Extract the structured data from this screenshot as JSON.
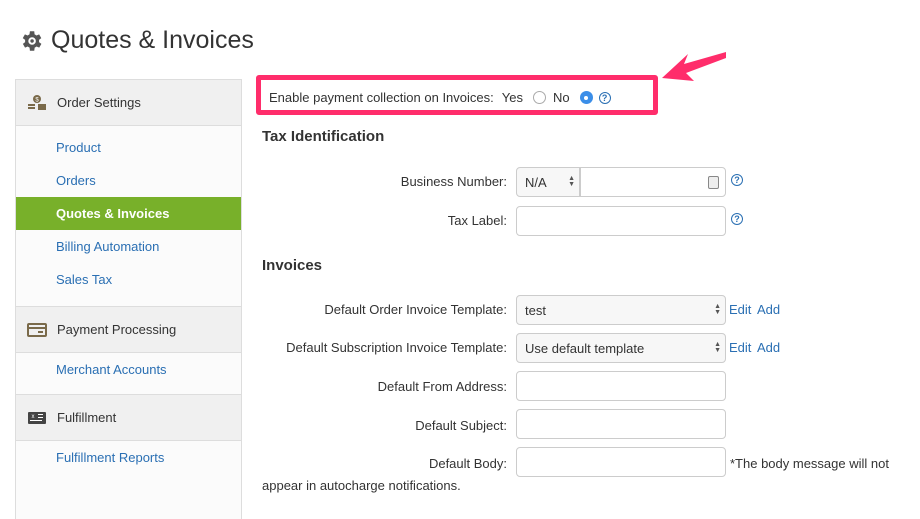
{
  "page": {
    "title": "Quotes & Invoices"
  },
  "sidebar": {
    "sections": [
      {
        "header": "Order Settings",
        "icon": "money-stack-icon",
        "items": [
          {
            "label": "Product",
            "active": false
          },
          {
            "label": "Orders",
            "active": false
          },
          {
            "label": "Quotes & Invoices",
            "active": true
          },
          {
            "label": "Billing Automation",
            "active": false
          },
          {
            "label": "Sales Tax",
            "active": false
          }
        ]
      },
      {
        "header": "Payment Processing",
        "icon": "credit-card-icon",
        "items": [
          {
            "label": "Merchant Accounts",
            "active": false
          }
        ]
      },
      {
        "header": "Fulfillment",
        "icon": "fulfillment-icon",
        "items": [
          {
            "label": "Fulfillment Reports",
            "active": false
          }
        ]
      }
    ]
  },
  "enable_payment": {
    "label": "Enable payment collection on Invoices:",
    "yes_label": "Yes",
    "no_label": "No",
    "selected": "No",
    "highlight_color": "#ff2d6b"
  },
  "tax": {
    "title": "Tax Identification",
    "business_number_label": "Business Number:",
    "business_number_type": "N/A",
    "business_number_value": "",
    "tax_label_label": "Tax Label:",
    "tax_label_value": ""
  },
  "invoices": {
    "title": "Invoices",
    "order_template_label": "Default Order Invoice Template:",
    "order_template_value": "test",
    "subscription_template_label": "Default Subscription Invoice Template:",
    "subscription_template_value": "Use default template",
    "edit_label": "Edit",
    "add_label": "Add",
    "from_address_label": "Default From Address:",
    "from_address_value": "",
    "subject_label": "Default Subject:",
    "subject_value": "",
    "body_label": "Default Body:",
    "body_value": "",
    "body_note_line1": "*The body message will not",
    "body_note_line2": "appear in autocharge notifications."
  },
  "colors": {
    "accent_green": "#78b02a",
    "link_blue": "#2a6fb3",
    "radio_blue": "#3b8ee8"
  }
}
